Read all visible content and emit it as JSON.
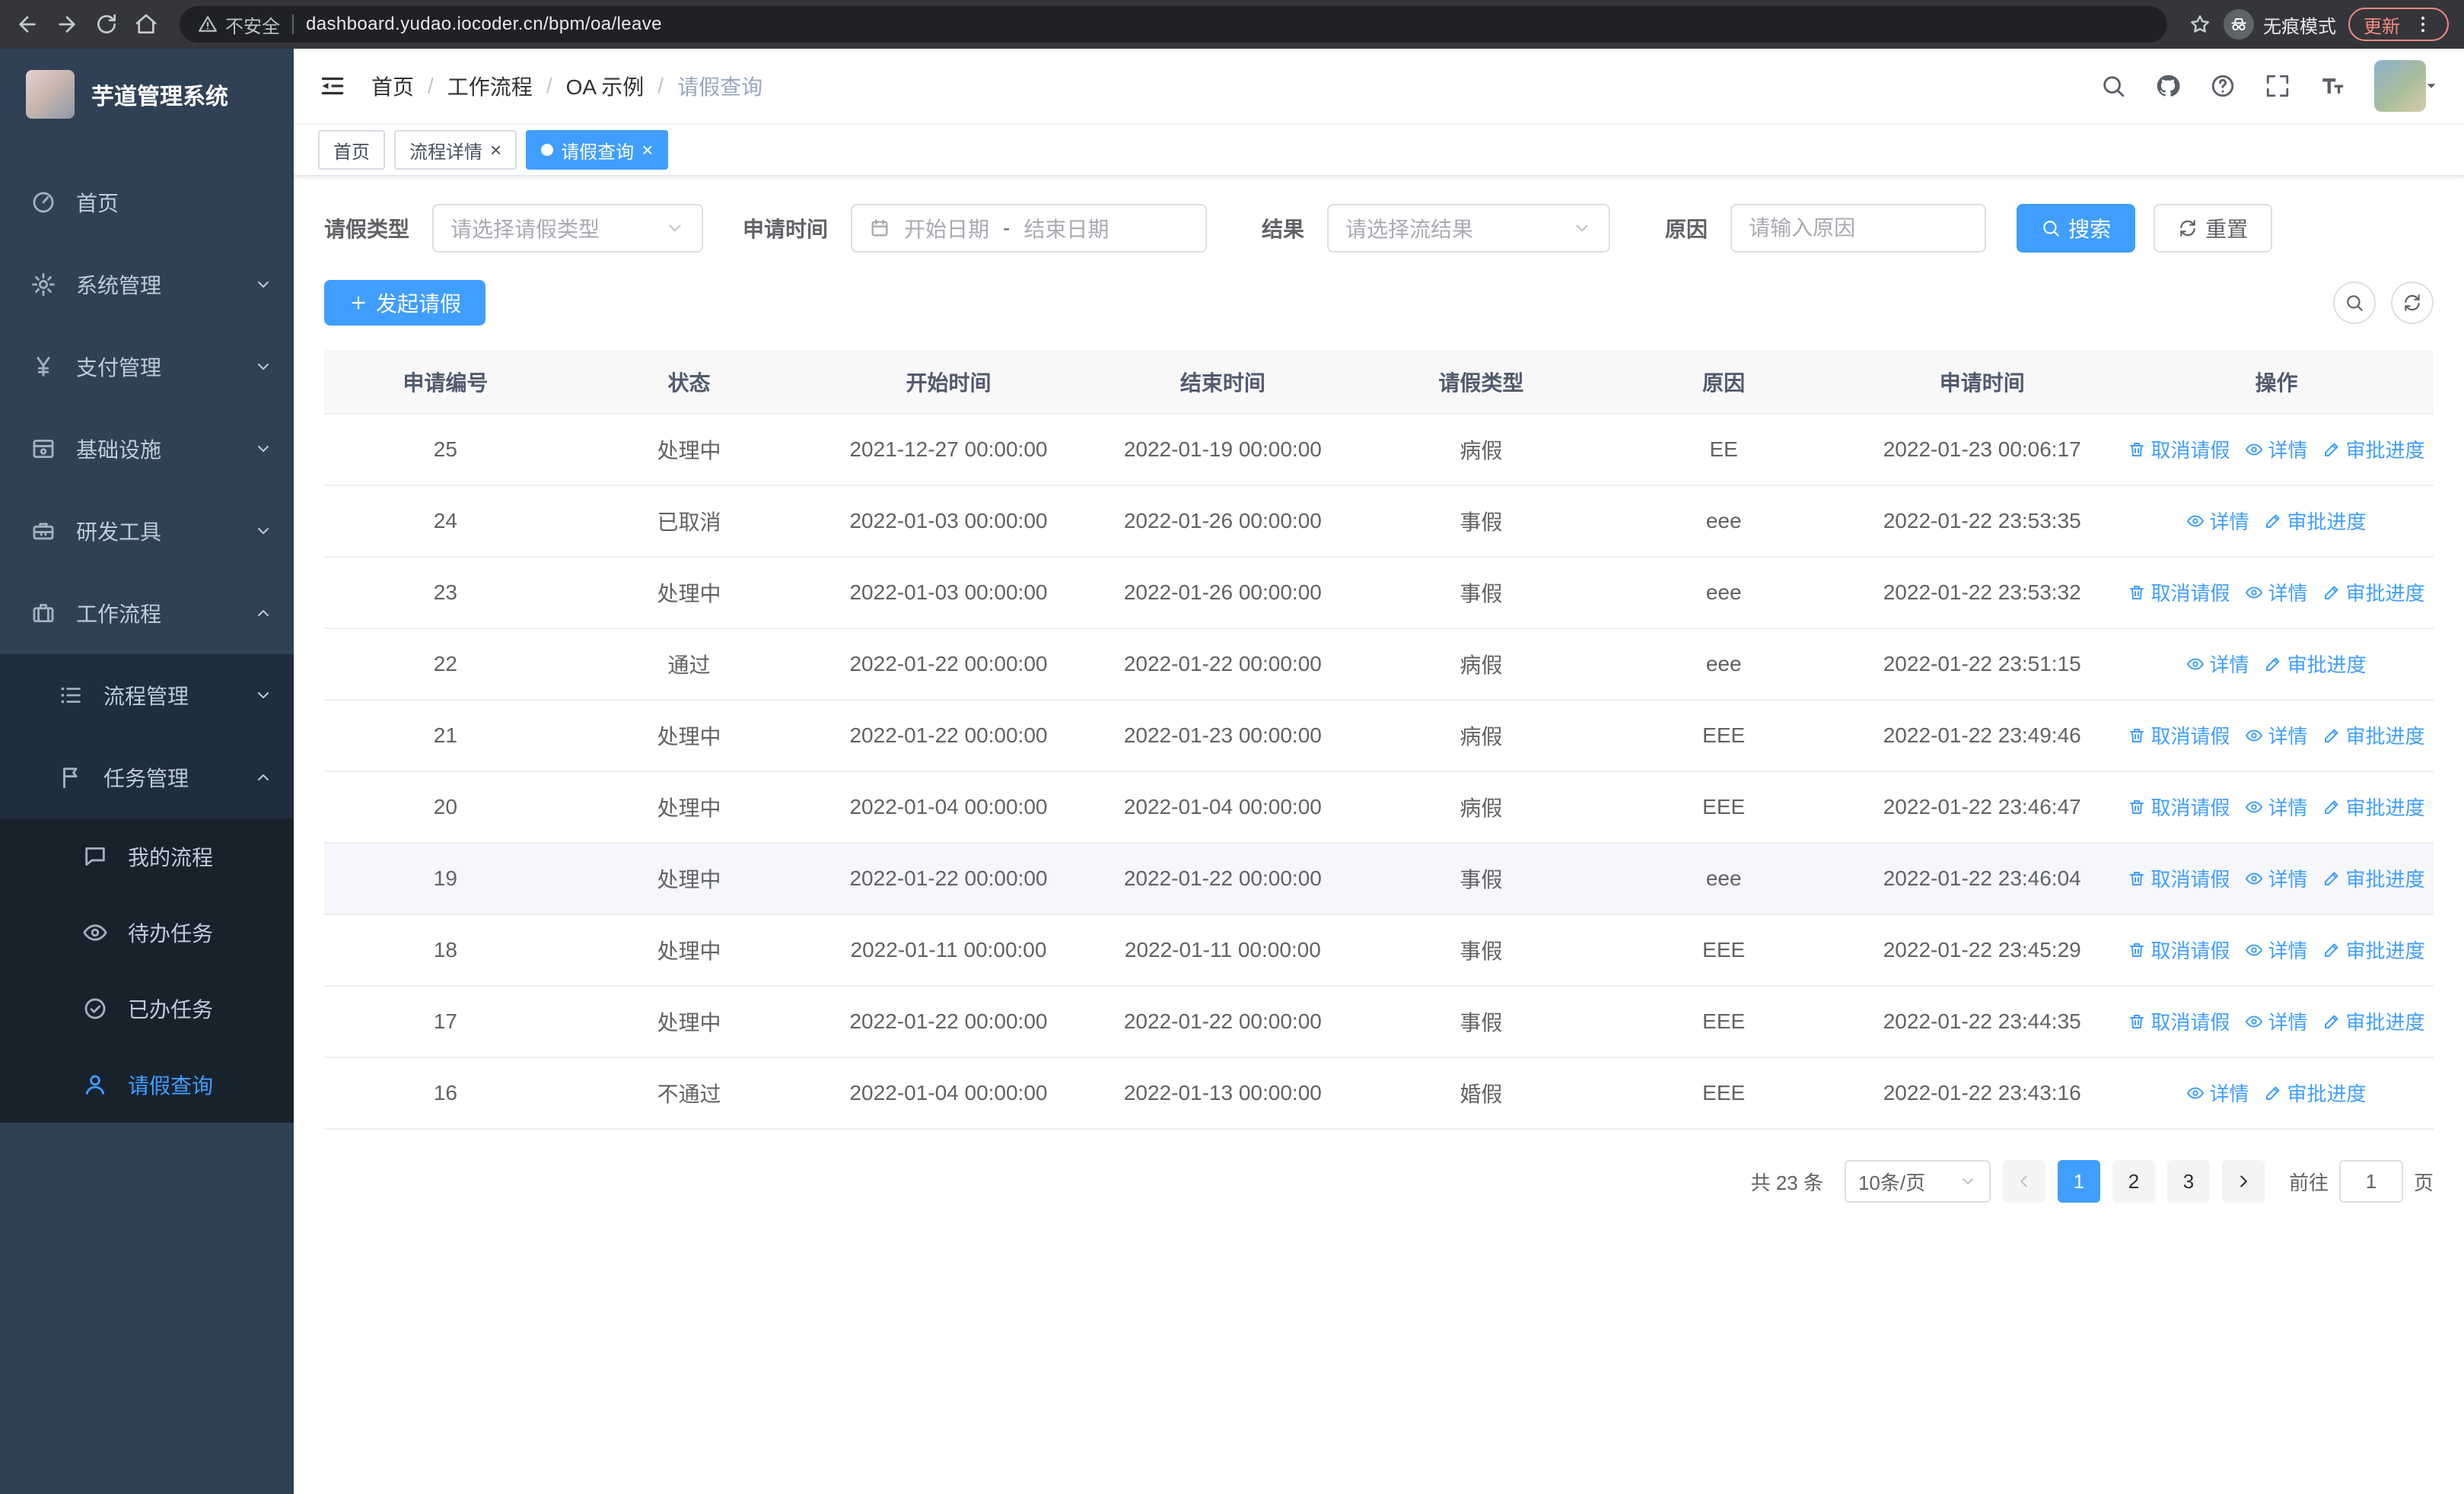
{
  "colors": {
    "primary": "#409eff",
    "sidebar_bg": "#304156",
    "submenu_bg": "#1f2d3d",
    "submenu3_bg": "#18222d",
    "update_accent": "#f28b82"
  },
  "browser": {
    "nav_icons": [
      "back-icon",
      "forward-icon",
      "reload-icon",
      "home-icon"
    ],
    "warning": "不安全",
    "url": "dashboard.yudao.iocoder.cn/bpm/oa/leave",
    "incognito": "无痕模式",
    "update": "更新"
  },
  "sidebar": {
    "title": "芋道管理系统",
    "menu": [
      {
        "label": "首页",
        "icon": "dashboard-icon",
        "level": 1,
        "arrow": null,
        "active": false
      },
      {
        "label": "系统管理",
        "icon": "gear-icon",
        "level": 1,
        "arrow": "down",
        "active": false
      },
      {
        "label": "支付管理",
        "icon": "yen-icon",
        "level": 1,
        "arrow": "down",
        "active": false
      },
      {
        "label": "基础设施",
        "icon": "infra-icon",
        "level": 1,
        "arrow": "down",
        "active": false
      },
      {
        "label": "研发工具",
        "icon": "toolbox-icon",
        "level": 1,
        "arrow": "down",
        "active": false
      },
      {
        "label": "工作流程",
        "icon": "briefcase-icon",
        "level": 1,
        "arrow": "up",
        "active": false
      },
      {
        "label": "流程管理",
        "icon": "list-icon",
        "level": 2,
        "arrow": "down",
        "active": false
      },
      {
        "label": "任务管理",
        "icon": "flag-icon",
        "level": 2,
        "arrow": "up",
        "active": false
      },
      {
        "label": "我的流程",
        "icon": "chat-icon",
        "level": 3,
        "arrow": null,
        "active": false
      },
      {
        "label": "待办任务",
        "icon": "eye-icon",
        "level": 3,
        "arrow": null,
        "active": false
      },
      {
        "label": "已办任务",
        "icon": "done-icon",
        "level": 3,
        "arrow": null,
        "active": false
      },
      {
        "label": "请假查询",
        "icon": "user-icon",
        "level": 3,
        "arrow": null,
        "active": true
      }
    ]
  },
  "header": {
    "breadcrumb": [
      "首页",
      "工作流程",
      "OA 示例",
      "请假查询"
    ],
    "right_icons": [
      "search-icon",
      "github-icon",
      "help-icon",
      "fullscreen-icon",
      "font-size-icon"
    ]
  },
  "tabs": [
    {
      "label": "首页",
      "closable": false,
      "active": false
    },
    {
      "label": "流程详情",
      "closable": true,
      "active": false
    },
    {
      "label": "请假查询",
      "closable": true,
      "active": true
    }
  ],
  "filters": {
    "leave_type_label": "请假类型",
    "leave_type_placeholder": "请选择请假类型",
    "apply_time_label": "申请时间",
    "start_date_placeholder": "开始日期",
    "range_separator": "-",
    "end_date_placeholder": "结束日期",
    "result_label": "结果",
    "result_placeholder": "请选择流结果",
    "reason_label": "原因",
    "reason_placeholder": "请输入原因",
    "search_button": "搜索",
    "reset_button": "重置"
  },
  "toolbar": {
    "create_button": "发起请假",
    "right_icons": [
      "search-icon",
      "refresh-icon"
    ]
  },
  "table": {
    "columns": [
      "申请编号",
      "状态",
      "开始时间",
      "结束时间",
      "请假类型",
      "原因",
      "申请时间",
      "操作"
    ],
    "op_defs": {
      "cancel": {
        "label": "取消请假",
        "icon": "trash-icon"
      },
      "detail": {
        "label": "详情",
        "icon": "eye-icon"
      },
      "progress": {
        "label": "审批进度",
        "icon": "edit-icon"
      }
    },
    "rows": [
      {
        "id": "25",
        "status": "处理中",
        "start": "2021-12-27 00:00:00",
        "end": "2022-01-19 00:00:00",
        "type": "病假",
        "reason": "EE",
        "apply": "2022-01-23 00:06:17",
        "ops": [
          "cancel",
          "detail",
          "progress"
        ],
        "hover": false
      },
      {
        "id": "24",
        "status": "已取消",
        "start": "2022-01-03 00:00:00",
        "end": "2022-01-26 00:00:00",
        "type": "事假",
        "reason": "eee",
        "apply": "2022-01-22 23:53:35",
        "ops": [
          "detail",
          "progress"
        ],
        "hover": false
      },
      {
        "id": "23",
        "status": "处理中",
        "start": "2022-01-03 00:00:00",
        "end": "2022-01-26 00:00:00",
        "type": "事假",
        "reason": "eee",
        "apply": "2022-01-22 23:53:32",
        "ops": [
          "cancel",
          "detail",
          "progress"
        ],
        "hover": false
      },
      {
        "id": "22",
        "status": "通过",
        "start": "2022-01-22 00:00:00",
        "end": "2022-01-22 00:00:00",
        "type": "病假",
        "reason": "eee",
        "apply": "2022-01-22 23:51:15",
        "ops": [
          "detail",
          "progress"
        ],
        "hover": false
      },
      {
        "id": "21",
        "status": "处理中",
        "start": "2022-01-22 00:00:00",
        "end": "2022-01-23 00:00:00",
        "type": "病假",
        "reason": "EEE",
        "apply": "2022-01-22 23:49:46",
        "ops": [
          "cancel",
          "detail",
          "progress"
        ],
        "hover": false
      },
      {
        "id": "20",
        "status": "处理中",
        "start": "2022-01-04 00:00:00",
        "end": "2022-01-04 00:00:00",
        "type": "病假",
        "reason": "EEE",
        "apply": "2022-01-22 23:46:47",
        "ops": [
          "cancel",
          "detail",
          "progress"
        ],
        "hover": false
      },
      {
        "id": "19",
        "status": "处理中",
        "start": "2022-01-22 00:00:00",
        "end": "2022-01-22 00:00:00",
        "type": "事假",
        "reason": "eee",
        "apply": "2022-01-22 23:46:04",
        "ops": [
          "cancel",
          "detail",
          "progress"
        ],
        "hover": true
      },
      {
        "id": "18",
        "status": "处理中",
        "start": "2022-01-11 00:00:00",
        "end": "2022-01-11 00:00:00",
        "type": "事假",
        "reason": "EEE",
        "apply": "2022-01-22 23:45:29",
        "ops": [
          "cancel",
          "detail",
          "progress"
        ],
        "hover": false
      },
      {
        "id": "17",
        "status": "处理中",
        "start": "2022-01-22 00:00:00",
        "end": "2022-01-22 00:00:00",
        "type": "事假",
        "reason": "EEE",
        "apply": "2022-01-22 23:44:35",
        "ops": [
          "cancel",
          "detail",
          "progress"
        ],
        "hover": false
      },
      {
        "id": "16",
        "status": "不通过",
        "start": "2022-01-04 00:00:00",
        "end": "2022-01-13 00:00:00",
        "type": "婚假",
        "reason": "EEE",
        "apply": "2022-01-22 23:43:16",
        "ops": [
          "detail",
          "progress"
        ],
        "hover": false
      }
    ]
  },
  "pagination": {
    "total": "共 23 条",
    "page_size": "10条/页",
    "pages": [
      "1",
      "2",
      "3"
    ],
    "active_page": "1",
    "goto_label": "前往",
    "goto_value": "1",
    "goto_suffix": "页"
  }
}
